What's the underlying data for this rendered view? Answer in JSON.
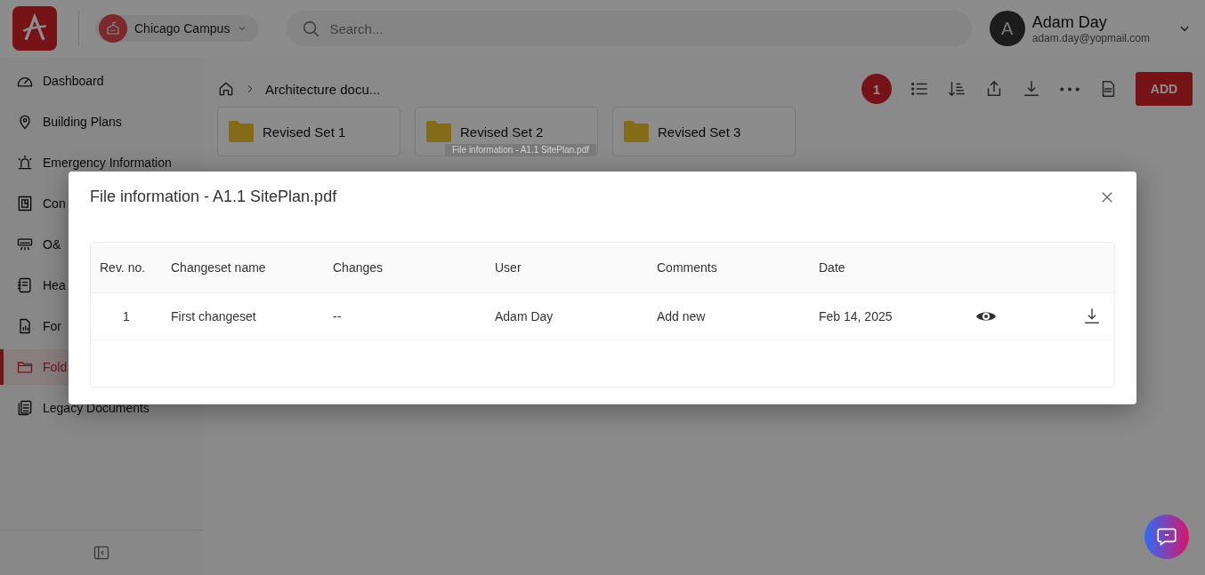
{
  "header": {
    "campus": "Chicago Campus",
    "search": {
      "placeholder": "Search..."
    },
    "user": {
      "initial": "A",
      "name": "Adam Day",
      "email": "adam.day@yopmail.com"
    }
  },
  "sidebar": {
    "items": [
      {
        "label": "Dashboard",
        "kind": "gauge",
        "selected": false
      },
      {
        "label": "Building Plans",
        "kind": "pin",
        "selected": false
      },
      {
        "label": "Emergency Information",
        "kind": "siren",
        "selected": false
      },
      {
        "label": "Con",
        "kind": "plan",
        "selected": false
      },
      {
        "label": "O&",
        "kind": "unit",
        "selected": false
      },
      {
        "label": "Hea",
        "kind": "notebook",
        "selected": false
      },
      {
        "label": "For",
        "kind": "report",
        "selected": false
      },
      {
        "label": "Fold",
        "kind": "folder",
        "selected": true
      },
      {
        "label": "Legacy Documents",
        "kind": "docs",
        "selected": false
      }
    ]
  },
  "breadcrumb": {
    "current": "Architecture docu..."
  },
  "toolbar": {
    "badge": "1",
    "add": "ADD"
  },
  "folders": [
    {
      "name": "Revised Set 1"
    },
    {
      "name": "Revised Set 2"
    },
    {
      "name": "Revised Set 3"
    }
  ],
  "tooltip": "File information - A1.1 SitePlan.pdf",
  "dialog": {
    "title": "File information - A1.1 SitePlan.pdf",
    "table": {
      "columns": [
        "Rev. no.",
        "Changeset name",
        "Changes",
        "User",
        "Comments",
        "Date"
      ],
      "rows": [
        {
          "cells": [
            "1",
            "First changeset",
            "--",
            "Adam Day",
            "Add new",
            "Feb 14, 2025"
          ]
        }
      ]
    }
  }
}
